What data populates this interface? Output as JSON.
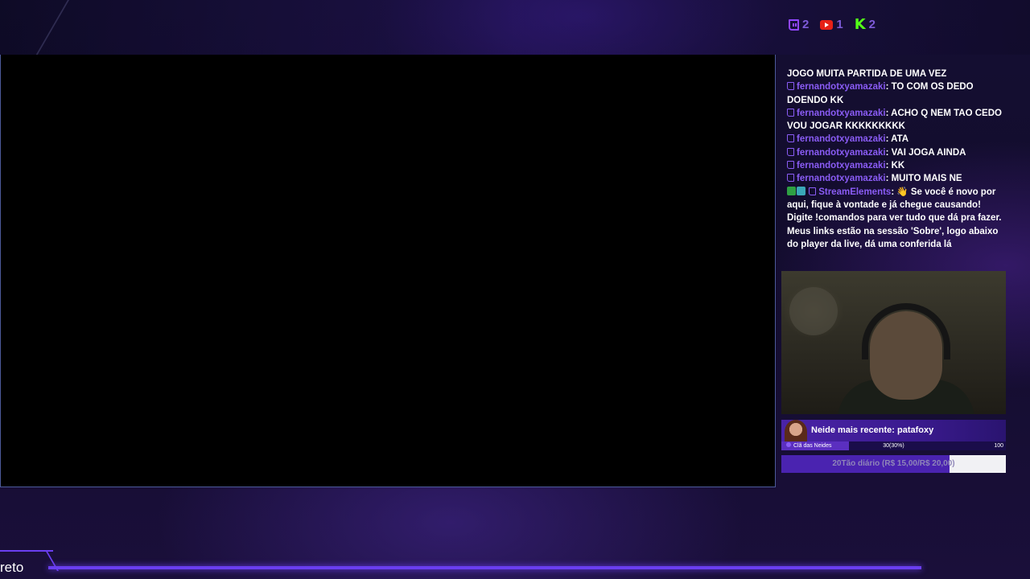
{
  "viewer_counts": [
    {
      "platform": "twitch",
      "icon": "twitch-icon",
      "count": "2"
    },
    {
      "platform": "youtube",
      "icon": "youtube-icon",
      "count": "1"
    },
    {
      "platform": "kick",
      "icon": "kick-icon",
      "count": "2"
    }
  ],
  "chat": {
    "messages": [
      {
        "platform_icon": "",
        "badges": [],
        "user": "",
        "text": "JOGO MUITA PARTIDA DE UMA VEZ"
      },
      {
        "platform_icon": "twitch-icon",
        "badges": [],
        "user": "fernandotxyamazaki",
        "text": ": TO COM OS DEDO DOENDO KK"
      },
      {
        "platform_icon": "twitch-icon",
        "badges": [],
        "user": "fernandotxyamazaki",
        "text": ": ACHO Q NEM TAO CEDO VOU JOGAR KKKKKKKKK"
      },
      {
        "platform_icon": "twitch-icon",
        "badges": [],
        "user": "fernandotxyamazaki",
        "text": ": ATA"
      },
      {
        "platform_icon": "twitch-icon",
        "badges": [],
        "user": "fernandotxyamazaki",
        "text": ": VAI JOGA AINDA"
      },
      {
        "platform_icon": "twitch-icon",
        "badges": [],
        "user": "fernandotxyamazaki",
        "text": ": KK"
      },
      {
        "platform_icon": "twitch-icon",
        "badges": [],
        "user": "fernandotxyamazaki",
        "text": ": MUITO MAIS NE"
      },
      {
        "platform_icon": "twitch-icon",
        "badges": [
          "verified-badge",
          "moderator-badge"
        ],
        "user": "StreamElements",
        "text": ": 👋 Se você é novo por aqui, fique à vontade e já chegue causando! Digite !comandos para ver tudo que dá pra fazer. Meus links estão na sessão 'Sobre', logo abaixo do player da live, dá uma conferida lá"
      }
    ]
  },
  "latest_member": {
    "title": "Neide mais recente: patafoxy",
    "goal_label": "Clã das Neides",
    "goal_progress": "30(30%)",
    "goal_max": "100",
    "goal_fraction": 0.3
  },
  "sub_goal": {
    "text": "20Tão diário (R$ 15,00/R$ 20,00)",
    "fraction": 0.75
  },
  "bottom_banner": {
    "text": "reto"
  },
  "colors": {
    "accent": "#6a3ef0",
    "username": "#8a5cf5",
    "goal_bar": "#4a23a8"
  }
}
